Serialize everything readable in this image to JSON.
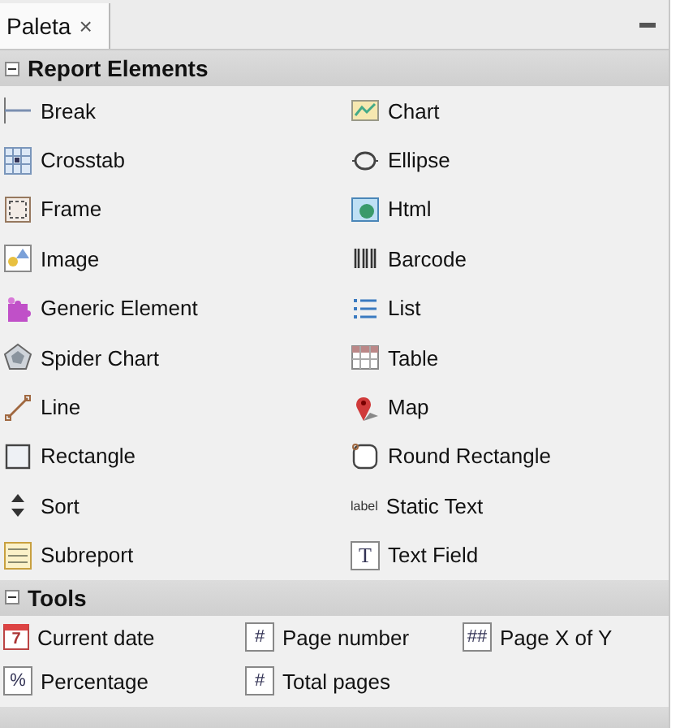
{
  "tab": {
    "label": "Paleta",
    "close": "×",
    "selected": true
  },
  "sections": [
    {
      "title": "Report Elements",
      "expanded": true,
      "kind": "two-column",
      "items": [
        {
          "label": "Break"
        },
        {
          "label": "Chart"
        },
        {
          "label": "Crosstab"
        },
        {
          "label": "Ellipse"
        },
        {
          "label": "Frame"
        },
        {
          "label": "Html"
        },
        {
          "label": "Image"
        },
        {
          "label": "Barcode"
        },
        {
          "label": "Generic Element"
        },
        {
          "label": "List"
        },
        {
          "label": "Spider Chart"
        },
        {
          "label": "Table"
        },
        {
          "label": "Line"
        },
        {
          "label": "Map"
        },
        {
          "label": "Rectangle"
        },
        {
          "label": "Round Rectangle"
        },
        {
          "label": "Sort"
        },
        {
          "label": "Static Text",
          "icon_text": "label"
        },
        {
          "label": "Subreport"
        },
        {
          "label": "Text Field",
          "icon_text": "T"
        }
      ]
    },
    {
      "title": "Tools",
      "expanded": true,
      "kind": "three-column",
      "items": [
        {
          "label": "Current date",
          "icon_text": "7"
        },
        {
          "label": "Page number",
          "icon_text": "#"
        },
        {
          "label": "Page X of Y",
          "icon_text": "##"
        },
        {
          "label": "Percentage",
          "icon_text": "%"
        },
        {
          "label": "Total pages",
          "icon_text": "#"
        }
      ]
    }
  ]
}
